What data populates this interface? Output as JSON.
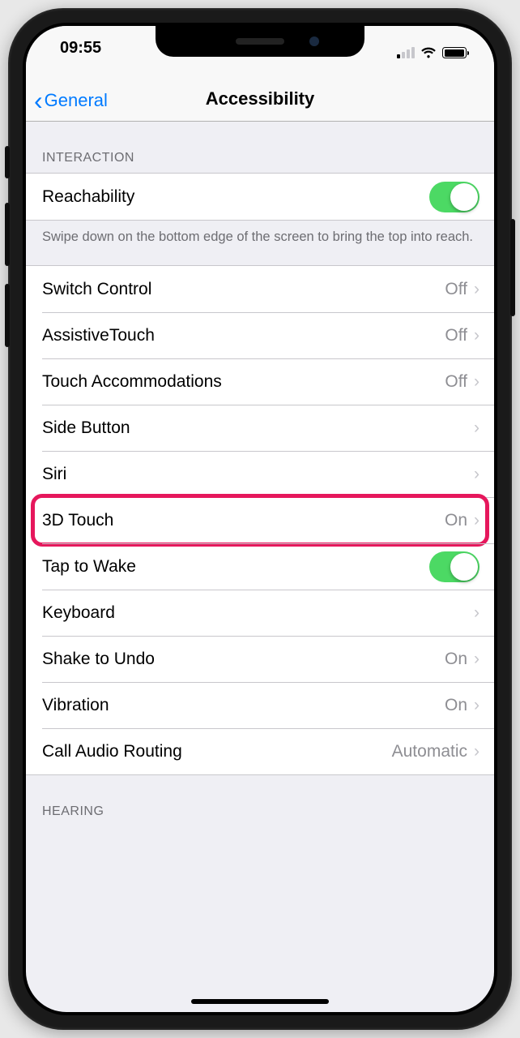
{
  "status": {
    "time": "09:55"
  },
  "nav": {
    "back": "General",
    "title": "Accessibility"
  },
  "sections": {
    "interaction_header": "Interaction",
    "reachability": {
      "label": "Reachability",
      "footer": "Swipe down on the bottom edge of the screen to bring the top into reach."
    },
    "switch_control": {
      "label": "Switch Control",
      "value": "Off"
    },
    "assistive_touch": {
      "label": "AssistiveTouch",
      "value": "Off"
    },
    "touch_accommodations": {
      "label": "Touch Accommodations",
      "value": "Off"
    },
    "side_button": {
      "label": "Side Button"
    },
    "siri": {
      "label": "Siri"
    },
    "three_d_touch": {
      "label": "3D Touch",
      "value": "On"
    },
    "tap_to_wake": {
      "label": "Tap to Wake"
    },
    "keyboard": {
      "label": "Keyboard"
    },
    "shake_to_undo": {
      "label": "Shake to Undo",
      "value": "On"
    },
    "vibration": {
      "label": "Vibration",
      "value": "On"
    },
    "call_audio_routing": {
      "label": "Call Audio Routing",
      "value": "Automatic"
    },
    "hearing_header": "Hearing"
  }
}
